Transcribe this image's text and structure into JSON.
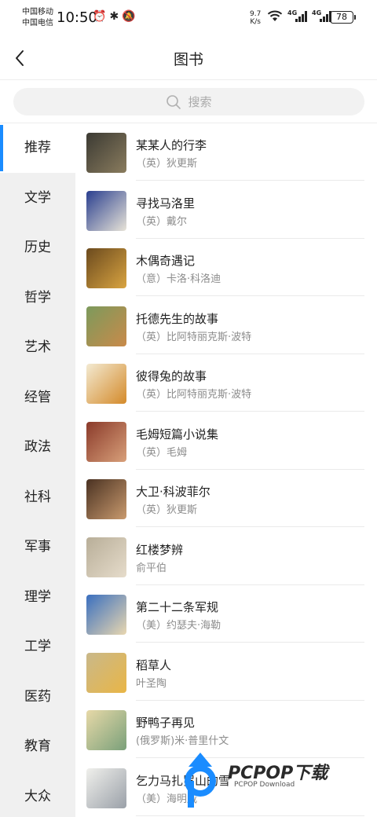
{
  "status_bar": {
    "carrier1": "中国移动",
    "carrier2": "中国电信",
    "time": "10:50",
    "net_speed_value": "9.7",
    "net_speed_unit": "K/s",
    "signal1_label": "4G",
    "signal2_label": "4G",
    "battery": "78"
  },
  "header": {
    "title": "图书"
  },
  "search": {
    "placeholder": "搜索"
  },
  "sidebar": {
    "items": [
      {
        "label": "推荐",
        "active": true
      },
      {
        "label": "文学"
      },
      {
        "label": "历史"
      },
      {
        "label": "哲学"
      },
      {
        "label": "艺术"
      },
      {
        "label": "经管"
      },
      {
        "label": "政法"
      },
      {
        "label": "社科"
      },
      {
        "label": "军事"
      },
      {
        "label": "理学"
      },
      {
        "label": "工学"
      },
      {
        "label": "医药"
      },
      {
        "label": "教育"
      },
      {
        "label": "大众"
      }
    ]
  },
  "books": [
    {
      "title": "某某人的行李",
      "author": "（英）狄更斯",
      "c1": "#3b3a33",
      "c2": "#8a7c5e"
    },
    {
      "title": "寻找马洛里",
      "author": "（英）戴尔",
      "c1": "#2a3f8f",
      "c2": "#e8e4d8"
    },
    {
      "title": "木偶奇遇记",
      "author": "（意）卡洛·科洛迪",
      "c1": "#6b4a1e",
      "c2": "#d9a441"
    },
    {
      "title": "托德先生的故事",
      "author": "（英）比阿特丽克斯·波特",
      "c1": "#7c9a5c",
      "c2": "#c98a4a"
    },
    {
      "title": "彼得兔的故事",
      "author": "（英）比阿特丽克斯·波特",
      "c1": "#f3ead2",
      "c2": "#d48a2a"
    },
    {
      "title": "毛姆短篇小说集",
      "author": "（英）毛姆",
      "c1": "#8a3a2a",
      "c2": "#d8a07a"
    },
    {
      "title": "大卫·科波菲尔",
      "author": "（英）狄更斯",
      "c1": "#4a3222",
      "c2": "#c99a6e"
    },
    {
      "title": "红楼梦辨",
      "author": "俞平伯",
      "c1": "#b8ae98",
      "c2": "#e6dccb"
    },
    {
      "title": "第二十二条军规",
      "author": "（美）约瑟夫·海勒",
      "c1": "#3a6fbf",
      "c2": "#e9d7b0"
    },
    {
      "title": "稻草人",
      "author": "叶圣陶",
      "c1": "#c9b88a",
      "c2": "#e9b646"
    },
    {
      "title": "野鸭子再见",
      "author": "(俄罗斯)米·普里什文",
      "c1": "#e7d9a8",
      "c2": "#7aa07a"
    },
    {
      "title": "乞力马扎罗山的雪",
      "author": "（美）海明威",
      "c1": "#f0f0ec",
      "c2": "#9aa0a8"
    }
  ],
  "watermark": {
    "brand": "PCPOP下载",
    "sub": "PCPOP Download"
  },
  "icons": [
    "back-arrow-icon",
    "search-icon",
    "wifi-icon",
    "alarm-icon",
    "bluetooth-icon",
    "mute-icon"
  ]
}
